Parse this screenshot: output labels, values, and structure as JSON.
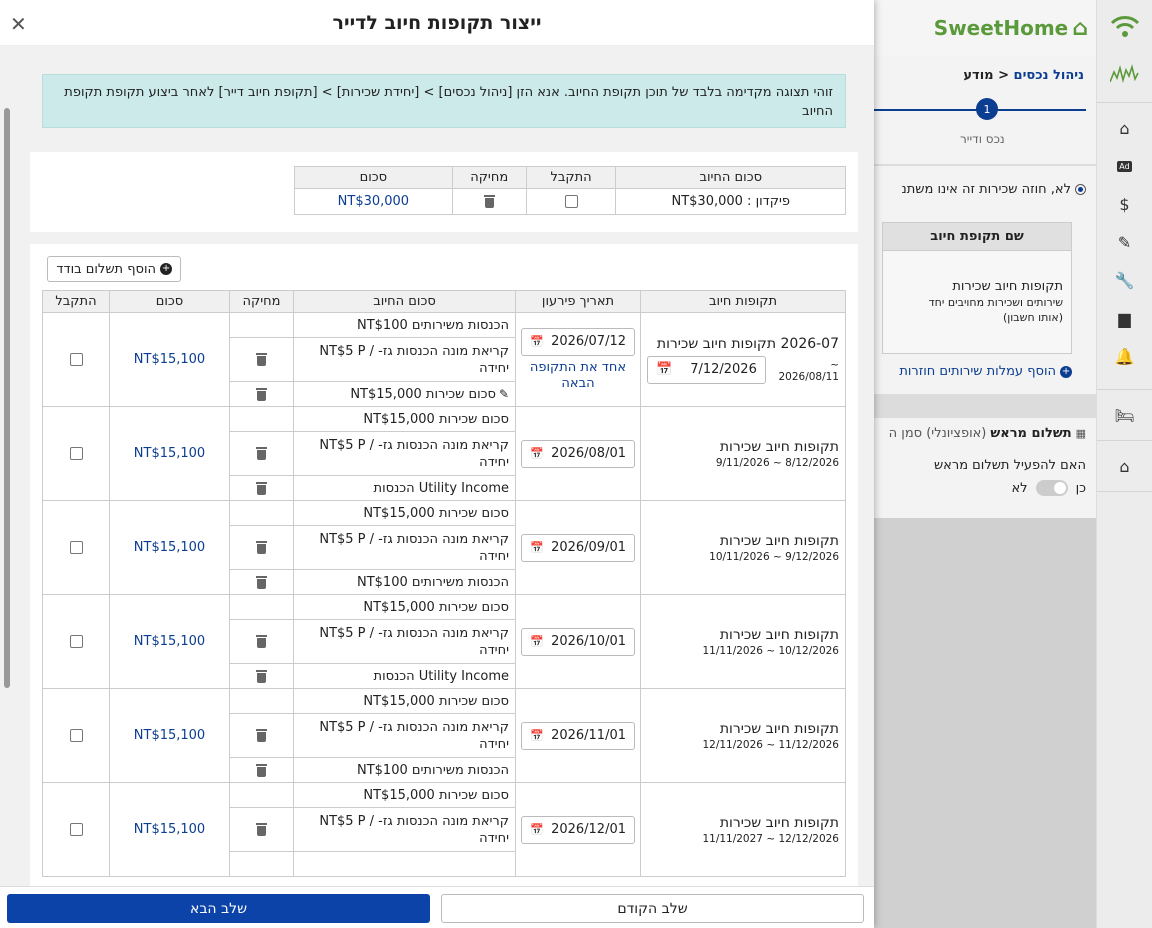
{
  "modal": {
    "title": "ייצור תקופות חיוב לדייר",
    "notice": "זוהי תצוגה מקדימה בלבד של תוכן תקופת החיוב. אנא הזן [ניהול נכסים] > [יחידת שכירות] > [תקופת חיוב דייר] לאחר ביצוע תקופת תקופת החיוב",
    "prev_button": "שלב הקודם",
    "next_button": "שלב הבא"
  },
  "deposit": {
    "headers": {
      "item": "סכום החיוב",
      "received": "התקבל",
      "delete": "מחיקה",
      "amount": "סכום"
    },
    "row": {
      "item": "פיקדון : NT$30,000",
      "amount": "NT$30,000"
    }
  },
  "periods": {
    "add_button": "הוסף תשלום בודד",
    "headers": {
      "period": "תקופות חיוב",
      "due": "תאריך פירעון",
      "item": "סכום החיוב",
      "delete": "מחיקה",
      "amount": "סכום",
      "received": "התקבל"
    },
    "merge_link": "אחד את התקופה הבאה",
    "rows": [
      {
        "title": "2026-07 תקופות חיוב שכירות",
        "dates": "~ 2026/08/11",
        "start": "7/12/2026",
        "due": "2026/07/12",
        "amount": "NT$15,100",
        "items": [
          "הכנסות משירותים NT$100",
          "קריאת מונה הכנסות גז- / NT$5 P יחידה",
          "סכום שכירות NT$15,000"
        ]
      },
      {
        "title": "תקופות חיוב שכירות",
        "dates": "8/12/2026 ~ 9/11/2026",
        "due": "2026/08/01",
        "amount": "NT$15,100",
        "items": [
          "סכום שכירות NT$15,000",
          "קריאת מונה הכנסות גז- / NT$5 P יחידה",
          "Utility Income הכנסות"
        ]
      },
      {
        "title": "תקופות חיוב שכירות",
        "dates": "9/12/2026 ~ 10/11/2026",
        "due": "2026/09/01",
        "amount": "NT$15,100",
        "items": [
          "סכום שכירות NT$15,000",
          "קריאת מונה הכנסות גז- / NT$5 P יחידה",
          "הכנסות משירותים NT$100"
        ]
      },
      {
        "title": "תקופות חיוב שכירות",
        "dates": "10/12/2026 ~ 11/11/2026",
        "due": "2026/10/01",
        "amount": "NT$15,100",
        "items": [
          "סכום שכירות NT$15,000",
          "קריאת מונה הכנסות גז- / NT$5 P יחידה",
          "Utility Income הכנסות"
        ]
      },
      {
        "title": "תקופות חיוב שכירות",
        "dates": "11/12/2026 ~ 12/11/2026",
        "due": "2026/11/01",
        "amount": "NT$15,100",
        "items": [
          "סכום שכירות NT$15,000",
          "קריאת מונה הכנסות גז- / NT$5 P יחידה",
          "הכנסות משירותים NT$100"
        ]
      },
      {
        "title": "תקופות חיוב שכירות",
        "dates": "12/12/2026 ~ 11/11/2027",
        "due": "2026/12/01",
        "amount": "NT$15,100",
        "items": [
          "סכום שכירות NT$15,000",
          "קריאת מונה הכנסות גז- / NT$5 P יחידה"
        ]
      }
    ]
  },
  "background": {
    "logo": "SweetHome",
    "breadcrumb_link": "ניהול נכסים",
    "breadcrumb_rest": "< מודע",
    "step_number": "1",
    "step_label": "נכס ודייר",
    "radio_text": "לא, חוזה שכירות זה אינו משתנ",
    "col_header": "שם תקופת חיוב",
    "cell_title": "תקופות חיוב שכירות",
    "cell_sub": "שירותים ושכירות מחויבים יחד",
    "cell_sub2": "(אותו חשבון)",
    "add_link": "הוסף עמלות שירותים חוזרות",
    "prepay_title": "תשלום מראש",
    "prepay_optional": "(אופציונלי) סמן ה",
    "prepay_question": "האם להפעיל תשלום מראש",
    "yes": "כן",
    "no": "לא"
  }
}
